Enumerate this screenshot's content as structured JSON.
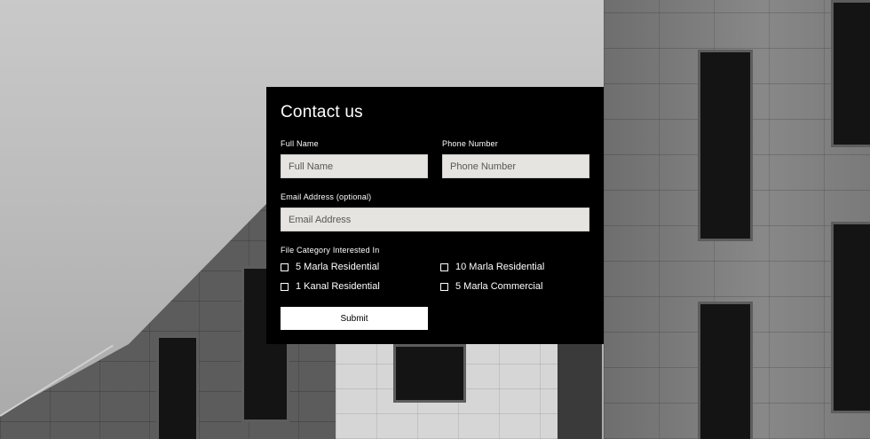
{
  "form": {
    "title": "Contact us",
    "full_name": {
      "label": "Full Name",
      "placeholder": "Full Name",
      "value": ""
    },
    "phone": {
      "label": "Phone Number",
      "placeholder": "Phone Number",
      "value": ""
    },
    "email": {
      "label": "Email Address (optional)",
      "placeholder": "Email Address",
      "value": ""
    },
    "category": {
      "label": "File Category Interested In",
      "options": [
        {
          "label": "5 Marla Residential",
          "checked": false
        },
        {
          "label": "10 Marla Residential",
          "checked": false
        },
        {
          "label": "1 Kanal Residential",
          "checked": false
        },
        {
          "label": "5 Marla Commercial",
          "checked": false
        }
      ]
    },
    "submit_label": "Submit"
  },
  "colors": {
    "panel_background": "#000000",
    "input_background": "#e5e4e0",
    "button_background": "#ffffff",
    "text": "#ffffff"
  }
}
